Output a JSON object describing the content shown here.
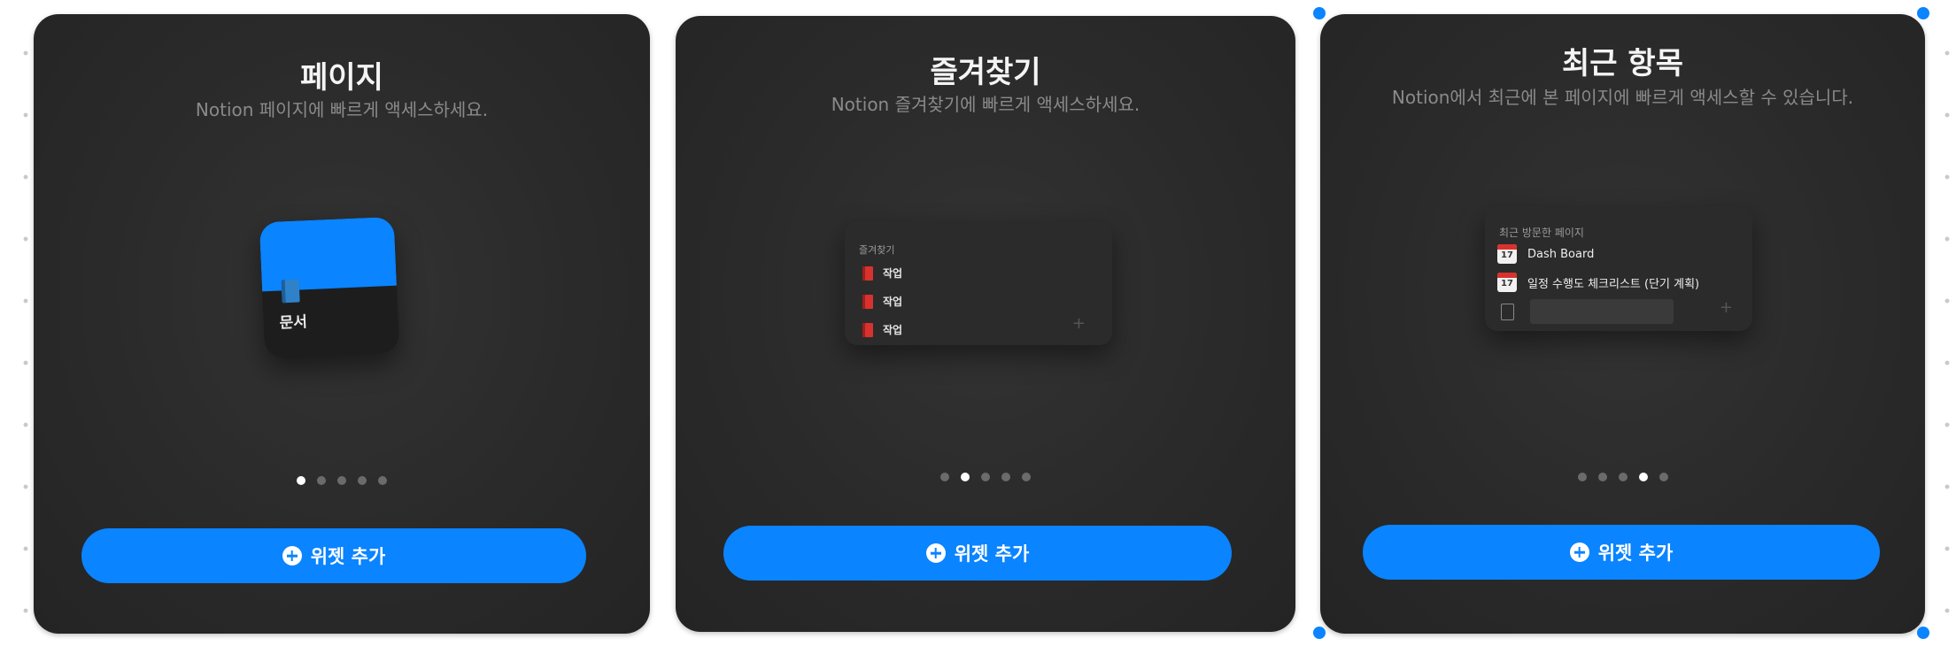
{
  "cards": [
    {
      "title": "페이지",
      "subtitle": "Notion 페이지에 빠르게 액세스하세요.",
      "widget": {
        "icon": "book-icon",
        "label": "문서"
      },
      "page_index": 0,
      "page_count": 5,
      "button_label": "위젯 추가"
    },
    {
      "title": "즐겨찾기",
      "subtitle": "Notion 즐겨찾기에 빠르게 액세스하세요.",
      "widget": {
        "header": "즐겨찾기",
        "items": [
          {
            "icon": "red-book-icon",
            "label": "작업"
          },
          {
            "icon": "red-book-icon",
            "label": "작업"
          },
          {
            "icon": "red-book-icon",
            "label": "작업"
          }
        ]
      },
      "page_index": 1,
      "page_count": 5,
      "button_label": "위젯 추가"
    },
    {
      "title": "최근 항목",
      "subtitle": "Notion에서 최근에 본 페이지에 빠르게 액세스할 수 있습니다.",
      "widget": {
        "header": "최근 방문한 페이지",
        "items": [
          {
            "icon": "calendar-icon",
            "calendar_day": "17",
            "label": "Dash Board"
          },
          {
            "icon": "calendar-icon",
            "calendar_day": "17",
            "label": "일정 수행도 체크리스트 (단기 계획)"
          },
          {
            "icon": "document-icon",
            "label": ""
          }
        ]
      },
      "page_index": 3,
      "page_count": 5,
      "button_label": "위젯 추가"
    }
  ],
  "colors": {
    "accent": "#0a84ff",
    "card_background": "#2a2a2a",
    "dot_active": "#ffffff",
    "dot_inactive": "#6b6b6b"
  }
}
